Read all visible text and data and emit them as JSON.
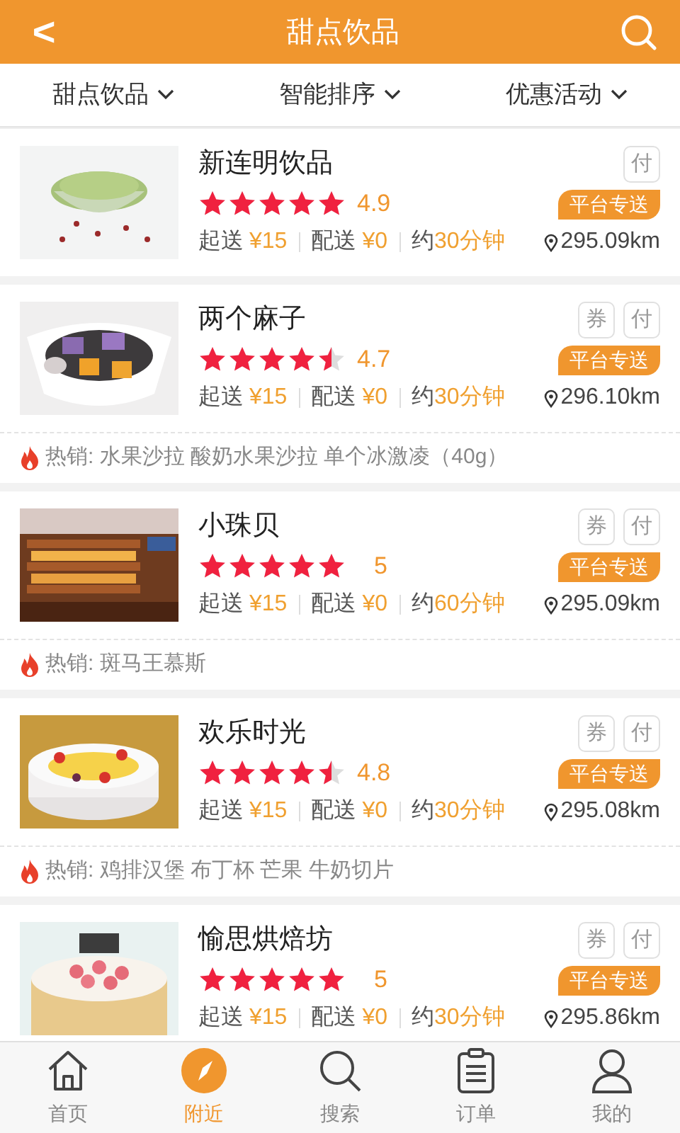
{
  "header": {
    "back": "<",
    "title": "甜点饮品"
  },
  "filters": [
    {
      "label": "甜点饮品"
    },
    {
      "label": "智能排序"
    },
    {
      "label": "优惠活动"
    }
  ],
  "shops": [
    {
      "name": "新连明饮品",
      "stars": 5,
      "rating": "4.9",
      "badges": [
        "付"
      ],
      "delivery_tag": "平台专送",
      "min_label": "起送",
      "min_order": "¥15",
      "fee_label": "配送",
      "fee": "¥0",
      "time_prefix": "约",
      "time": "30分钟",
      "distance": "295.09km"
    },
    {
      "name": "两个麻子",
      "stars": 4.5,
      "rating": "4.7",
      "badges": [
        "券",
        "付"
      ],
      "delivery_tag": "平台专送",
      "min_label": "起送",
      "min_order": "¥15",
      "fee_label": "配送",
      "fee": "¥0",
      "time_prefix": "约",
      "time": "30分钟",
      "distance": "296.10km",
      "hot": "热销: 水果沙拉 酸奶水果沙拉 单个冰激凌（40g）"
    },
    {
      "name": "小珠贝",
      "stars": 5,
      "rating": "5",
      "badges": [
        "券",
        "付"
      ],
      "delivery_tag": "平台专送",
      "min_label": "起送",
      "min_order": "¥15",
      "fee_label": "配送",
      "fee": "¥0",
      "time_prefix": "约",
      "time": "60分钟",
      "distance": "295.09km",
      "hot": "热销: 斑马王慕斯"
    },
    {
      "name": "欢乐时光",
      "stars": 4.5,
      "rating": "4.8",
      "badges": [
        "券",
        "付"
      ],
      "delivery_tag": "平台专送",
      "min_label": "起送",
      "min_order": "¥15",
      "fee_label": "配送",
      "fee": "¥0",
      "time_prefix": "约",
      "time": "30分钟",
      "distance": "295.08km",
      "hot": "热销: 鸡排汉堡 布丁杯 芒果 牛奶切片"
    },
    {
      "name": "愉思烘焙坊",
      "stars": 5,
      "rating": "5",
      "badges": [
        "券",
        "付"
      ],
      "delivery_tag": "平台专送",
      "min_label": "起送",
      "min_order": "¥15",
      "fee_label": "配送",
      "fee": "¥0",
      "time_prefix": "约",
      "time": "30分钟",
      "distance": "295.86km"
    }
  ],
  "tabs": [
    {
      "label": "首页",
      "selected": false
    },
    {
      "label": "附近",
      "selected": true
    },
    {
      "label": "搜索",
      "selected": false
    },
    {
      "label": "订单",
      "selected": false
    },
    {
      "label": "我的",
      "selected": false
    }
  ]
}
